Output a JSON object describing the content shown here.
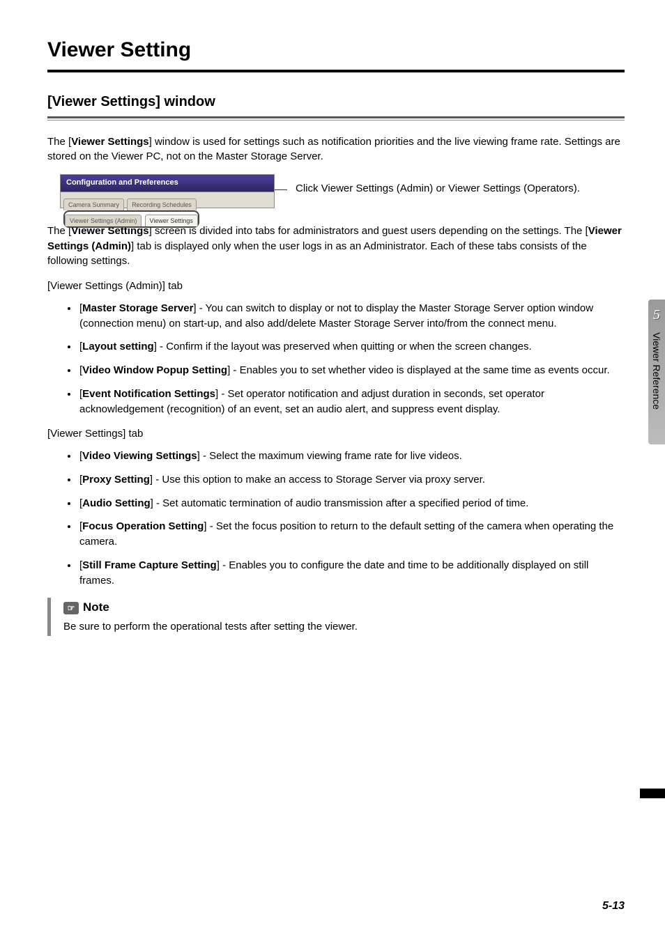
{
  "chapter": {
    "number": "5",
    "name": "Viewer Reference",
    "pagenum": "5-13"
  },
  "h1": "Viewer Setting",
  "h2": "[Viewer Settings] window",
  "intro": {
    "pre": "The [",
    "bold": "Viewer Settings",
    "post": "] window is used for settings such as notification priorities and the live viewing frame rate. Settings are stored on the Viewer PC, not on the Master Storage Server."
  },
  "figure": {
    "titlebar": "Configuration and Preferences",
    "tabs": {
      "t1": "Camera Summary",
      "t2": "Recording Schedules",
      "t3": "Viewer Settings (Admin)",
      "t4": "Viewer Settings"
    },
    "callout": "Click Viewer Settings (Admin) or Viewer Settings (Operators)."
  },
  "para2": {
    "s1a": "The [",
    "s1b": "Viewer Settings",
    "s1c": "] screen is divided into tabs for administrators and guest users depending on the settings. The [",
    "s1d": "Viewer Settings (Admin)",
    "s1e": "] tab is displayed only when the user logs in as an Administrator. Each of these tabs consists of the following settings."
  },
  "adminTab": {
    "heading": "[Viewer Settings (Admin)] tab",
    "items": [
      {
        "label": "Master Storage Server",
        "desc": " - You can switch to display or not to display the Master Storage Server option window (connection menu) on start-up, and also add/delete Master Storage Server into/from the connect menu."
      },
      {
        "label": "Layout setting",
        "desc": " - Confirm if the layout was preserved when quitting or when the screen changes."
      },
      {
        "label": "Video Window Popup Setting",
        "desc": " - Enables you to set whether video is displayed at the same time as events occur."
      },
      {
        "label": "Event Notification Settings",
        "desc": " - Set operator notification and adjust duration in seconds, set operator acknowledgement (recognition) of an event, set an audio alert, and suppress event display."
      }
    ]
  },
  "viewerTab": {
    "heading": "[Viewer Settings] tab",
    "items": [
      {
        "label": "Video Viewing Settings",
        "desc": " - Select the maximum viewing frame rate for live videos."
      },
      {
        "label": "Proxy Setting",
        "desc": " - Use this option to make an access to Storage Server via proxy server."
      },
      {
        "label": "Audio Setting",
        "desc": " - Set automatic termination of audio transmission after a specified period of time."
      },
      {
        "label": "Focus Operation Setting",
        "desc": " - Set the focus position to return to the default setting of the camera when operating the camera."
      },
      {
        "label": "Still Frame Capture Setting",
        "desc": " - Enables you to configure the date and time to be additionally displayed on still frames."
      }
    ]
  },
  "note": {
    "title": "Note",
    "body": "Be sure to perform the operational tests after setting the viewer."
  }
}
